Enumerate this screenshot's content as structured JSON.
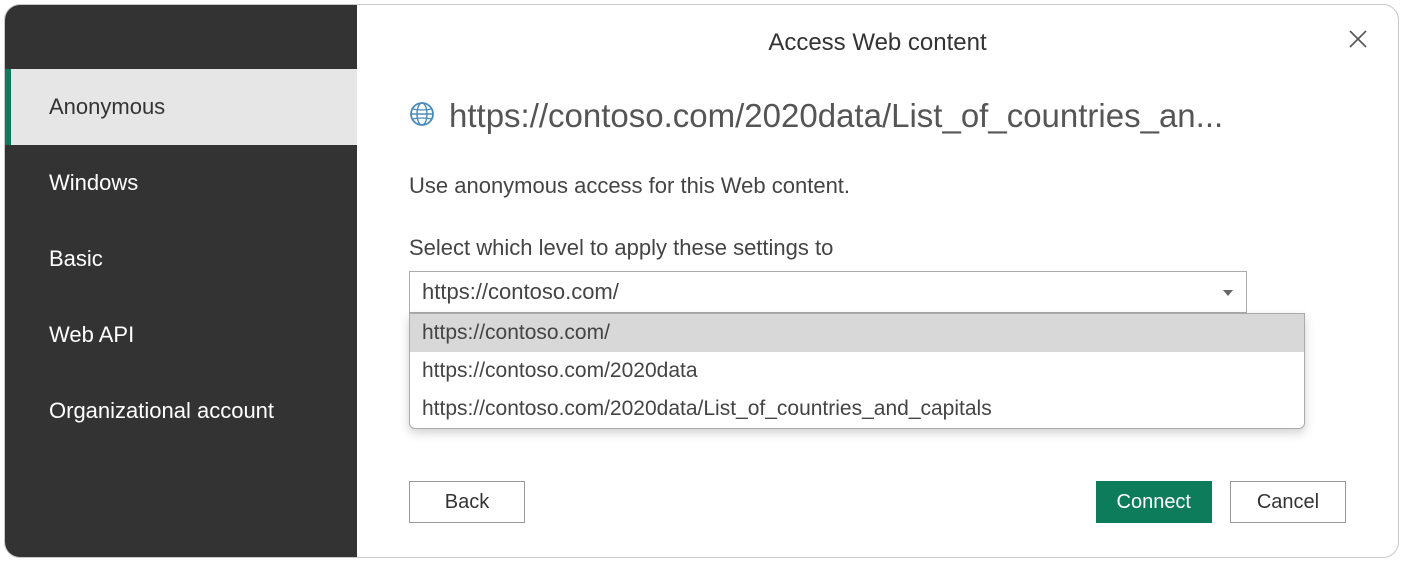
{
  "dialog": {
    "title": "Access Web content"
  },
  "sidebar": {
    "items": [
      {
        "label": "Anonymous",
        "selected": true
      },
      {
        "label": "Windows",
        "selected": false
      },
      {
        "label": "Basic",
        "selected": false
      },
      {
        "label": "Web API",
        "selected": false
      },
      {
        "label": "Organizational account",
        "selected": false
      }
    ]
  },
  "main": {
    "url": "https://contoso.com/2020data/List_of_countries_an...",
    "description": "Use anonymous access for this Web content.",
    "level_label": "Select which level to apply these settings to",
    "combo_value": "https://contoso.com/",
    "dropdown_options": [
      {
        "label": "https://contoso.com/",
        "highlight": true
      },
      {
        "label": "https://contoso.com/2020data",
        "highlight": false
      },
      {
        "label": "https://contoso.com/2020data/List_of_countries_and_capitals",
        "highlight": false
      }
    ]
  },
  "buttons": {
    "back": "Back",
    "connect": "Connect",
    "cancel": "Cancel"
  }
}
